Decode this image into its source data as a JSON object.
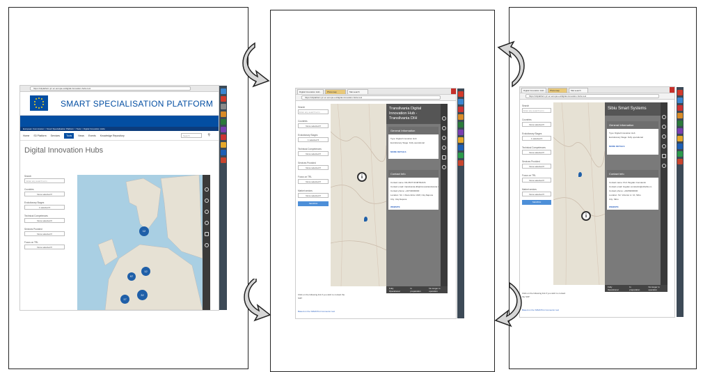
{
  "screen1": {
    "address": "https://s3platform.jrc.ec.europa.eu/digital-innovation-hubs-tool",
    "platform_title": "SMART SPECIALISATION PLATFORM",
    "breadcrumb": "European Commission > Smart Specialisation Platform > Tools > Digital Innovation Hubs",
    "nav": [
      "Home",
      "S3 Platform",
      "Services",
      "Tools",
      "News",
      "Events",
      "Knowledge Repository"
    ],
    "nav_search_placeholder": "Search",
    "page_heading": "Digital Innovation Hubs",
    "search_label": "Search",
    "search_placeholder": "Enter any search term",
    "filters": [
      {
        "label": "Countries",
        "value": "None selected ▾"
      },
      {
        "label": "Evolutionary Stages",
        "value": "1 selected ▾"
      },
      {
        "label": "Technical Competences",
        "value": "None selected ▾"
      },
      {
        "label": "Services Provided",
        "value": "None selected ▾"
      },
      {
        "label": "Focus on TRL",
        "value": "None selected ▾"
      }
    ],
    "clusters": [
      "12",
      "12",
      "97",
      "32",
      "17"
    ]
  },
  "screen2": {
    "tabs": [
      "Digital Innovation Hub...",
      "Photomap",
      "Mai search"
    ],
    "address": "https://s3platform.jrc.ec.europa.eu/digital-innovation-hubs-tool",
    "search_label": "Search",
    "search_placeholder": "Enter any search term",
    "filters": [
      {
        "label": "Countries",
        "value": "None selected ▾"
      },
      {
        "label": "Evolutionary Stages",
        "value": "1 selected ▾"
      },
      {
        "label": "Technical Competences",
        "value": "None selected ▾"
      },
      {
        "label": "Services Provided",
        "value": "None selected ▾"
      },
      {
        "label": "Focus on TRL",
        "value": "None selected ▾"
      },
      {
        "label": "Market sectors",
        "value": "None selected ▾"
      }
    ],
    "search_button": "SEARCH",
    "panel_title": "Transilvania Digital Innovation Hub - Transilvania DIH",
    "general_info_heading": "General Information",
    "general_info": [
      "Type: Digital Innovation Hub",
      "Evolutionary Stage: Fully operational"
    ],
    "more_details": "MORE DETAILS",
    "contact_heading": "Contact Info",
    "contact_info": [
      "Contact name: DIH BOT ROMTRANS",
      "Contact email: transilvania.dih@innovatransilvania.ro",
      "Contact phone: +40740000000",
      "Location: Str. 1 Decembrie 1918, Cluj-Napoca",
      "City: Cluj-Napoca"
    ],
    "website": "WEBSITE",
    "legend": [
      "Fully Operational",
      "In preparation",
      "No longer in operation"
    ],
    "bottom_note": "Click on the following link if you wish to contact the S3P:",
    "bottom_link": "Based on the S3MATCH Connector tool"
  },
  "screen3": {
    "tabs": [
      "Digital Innovation Hub...",
      "Photomap",
      "Mai search"
    ],
    "address": "https://s3platform.jrc.ec.europa.eu/digital-innovation-hubs-tool",
    "search_label": "Search",
    "search_placeholder": "Enter any search term",
    "filters": [
      {
        "label": "Countries",
        "value": "None selected ▾"
      },
      {
        "label": "Evolutionary Stages",
        "value": "1 selected ▾"
      },
      {
        "label": "Technical Competences",
        "value": "None selected ▾"
      },
      {
        "label": "Services Provided",
        "value": "None selected ▾"
      },
      {
        "label": "Focus on TRL",
        "value": "None selected ▾"
      },
      {
        "label": "Market sectors",
        "value": "None selected ▾"
      }
    ],
    "search_button": "SEARCH",
    "panel_title": "Sibiu Smart Systems",
    "general_info_heading": "General Information",
    "general_info": [
      "Type: Digital Innovation Hub",
      "Evolutionary Stage: Fully operational"
    ],
    "more_details": "MORE DETAILS",
    "contact_heading": "Contact Info",
    "contact_info": [
      "Contact name: Prof. Bogdan Constantin",
      "Contact email: bogdan.constantin@ulbsibiu.ro",
      "Contact phone: +40269000000",
      "Location: Str. Victoriei nr. 10, Sibiu",
      "City: Sibiu"
    ],
    "website": "WEBSITE",
    "legend": [
      "Fully Operational",
      "In preparation",
      "No longer in operation"
    ],
    "bottom_note": "Click on the following link if you wish to contact the S3P:",
    "bottom_link": "Based on the S3MATCH Connector tool"
  },
  "colors": {
    "ec_blue": "#034ea2",
    "link_blue": "#2c62c0",
    "panel_grey": "#7a7a7a",
    "cluster_blue": "#1f5fa8"
  }
}
